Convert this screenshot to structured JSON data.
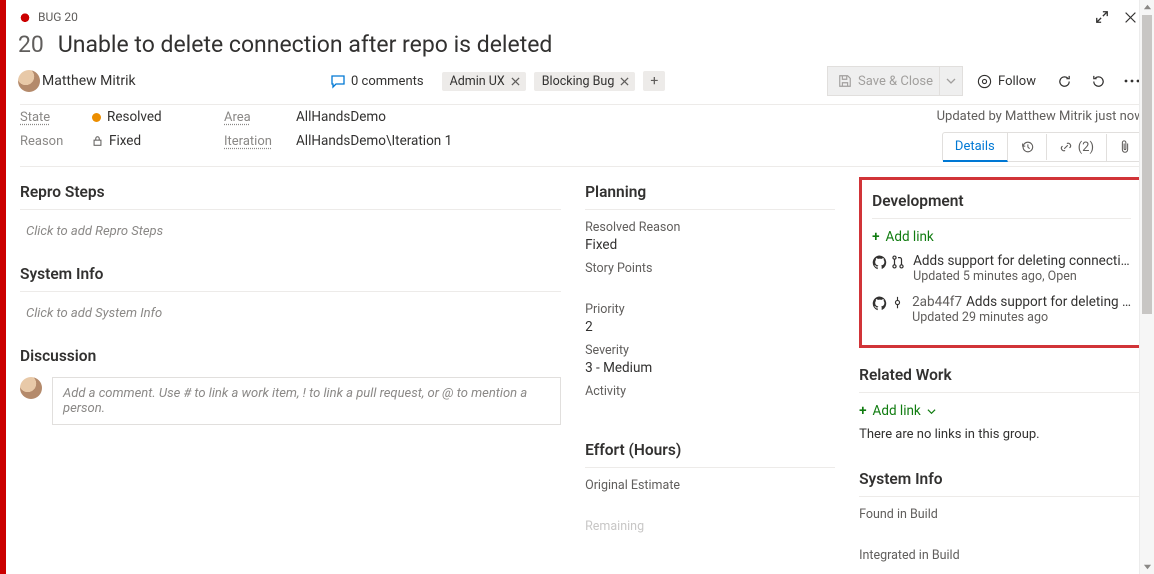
{
  "header": {
    "type_label": "BUG",
    "id": "20",
    "title": "Unable to delete connection after repo is deleted",
    "assignee": "Matthew Mitrik",
    "comments_label": "0 comments",
    "tags": [
      "Admin UX",
      "Blocking Bug"
    ],
    "save_label": "Save & Close",
    "follow_label": "Follow"
  },
  "fields": {
    "state_label": "State",
    "state_value": "Resolved",
    "reason_label": "Reason",
    "reason_value": "Fixed",
    "area_label": "Area",
    "area_value": "AllHandsDemo",
    "iteration_label": "Iteration",
    "iteration_value": "AllHandsDemo\\Iteration 1",
    "updated_by": "Updated by Matthew Mitrik just now"
  },
  "tabs": {
    "details": "Details",
    "links_count": "(2)"
  },
  "left": {
    "repro_title": "Repro Steps",
    "repro_placeholder": "Click to add Repro Steps",
    "sysinfo_title": "System Info",
    "sysinfo_placeholder": "Click to add System Info",
    "discussion_title": "Discussion",
    "discussion_placeholder": "Add a comment. Use # to link a work item, ! to link a pull request, or @ to mention a person."
  },
  "mid": {
    "planning_title": "Planning",
    "resolved_reason_label": "Resolved Reason",
    "resolved_reason_value": "Fixed",
    "story_points_label": "Story Points",
    "priority_label": "Priority",
    "priority_value": "2",
    "severity_label": "Severity",
    "severity_value": "3 - Medium",
    "activity_label": "Activity",
    "effort_title": "Effort (Hours)",
    "original_estimate_label": "Original Estimate",
    "remaining_label": "Remaining"
  },
  "right": {
    "dev_title": "Development",
    "add_link_label": "Add link",
    "dev_items": [
      {
        "title": "Adds support for deleting connecti…",
        "sub": "Updated 5 minutes ago,  Open",
        "kind": "pr"
      },
      {
        "hash": "2ab44f7",
        "title": "Adds support for deleting …",
        "sub": "Updated 29 minutes ago",
        "kind": "commit"
      }
    ],
    "related_title": "Related Work",
    "related_add_link": "Add link",
    "no_links": "There are no links in this group.",
    "sysinfo_title": "System Info",
    "found_in_build": "Found in Build",
    "integrated_in_build": "Integrated in Build"
  }
}
